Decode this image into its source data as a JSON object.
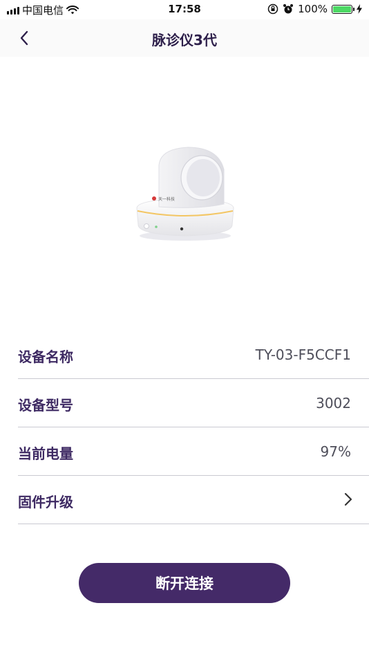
{
  "status_bar": {
    "carrier": "中国电信",
    "time": "17:58",
    "battery_percent": "100%",
    "battery_level": 1.0,
    "battery_color": "#4cd964"
  },
  "nav": {
    "title": "脉诊仪3代",
    "back_icon": "chevron-left-icon"
  },
  "device": {
    "image_alt": "device-image",
    "brand_text": "天一科技"
  },
  "info": {
    "rows": [
      {
        "label": "设备名称",
        "value": "TY-03-F5CCF1"
      },
      {
        "label": "设备型号",
        "value": "3002"
      },
      {
        "label": "当前电量",
        "value": "97%"
      },
      {
        "label": "固件升级",
        "value": ""
      }
    ]
  },
  "actions": {
    "disconnect_label": "断开连接"
  },
  "colors": {
    "accent": "#442a68",
    "label": "#3e2a63"
  }
}
